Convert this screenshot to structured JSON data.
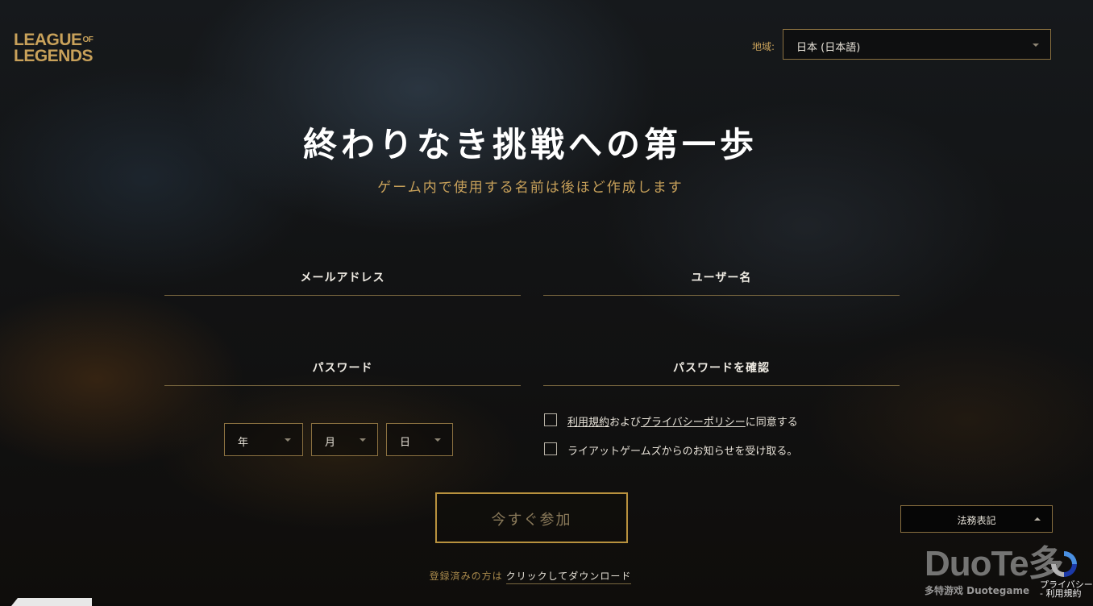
{
  "brand": {
    "line1": "LEAGUE",
    "of": "OF",
    "line2": "LEGENDS"
  },
  "region": {
    "label": "地域:",
    "value": "日本 (日本語)"
  },
  "hero": {
    "title": "終わりなき挑戦への第一歩",
    "subtitle": "ゲーム内で使用する名前は後ほど作成します"
  },
  "form": {
    "email_label": "メールアドレス",
    "username_label": "ユーザー名",
    "password_label": "パスワード",
    "confirm_label": "パスワードを確認",
    "birth": {
      "year": "年",
      "month": "月",
      "day": "日"
    },
    "terms": {
      "link1": "利用規約",
      "mid": "および",
      "link2": "プライバシーポリシー",
      "end": "に同意する"
    },
    "newsletter": "ライアットゲームズからのお知らせを受け取る。",
    "submit": "今すぐ参加"
  },
  "login": {
    "prompt": "登録済みの方は",
    "link": "クリックしてダウンロード"
  },
  "legal": {
    "label": "法務表記"
  },
  "watermark": {
    "big": "DuoTe多",
    "small": "多特游戏 Duotegame"
  },
  "recaptcha": {
    "line1": "プライバシー",
    "line2": "- 利用規約"
  }
}
